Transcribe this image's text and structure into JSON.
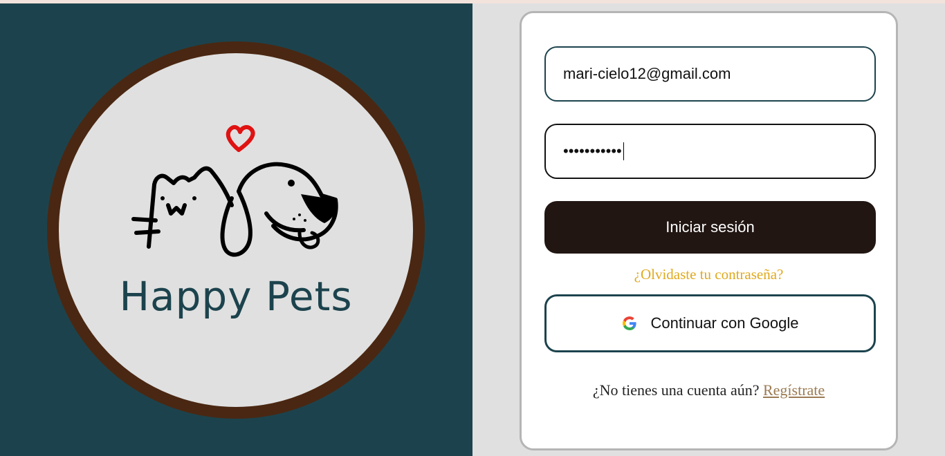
{
  "brand": {
    "name": "Happy Pets"
  },
  "login": {
    "email_value": "mari-cielo12@gmail.com",
    "password_masked": "•••••••••••",
    "submit_label": "Iniciar sesión",
    "forgot_label": "¿Olvidaste tu contraseña?",
    "google_label": "Continuar con Google",
    "signup_prompt": "¿No tienes una cuenta aún?",
    "signup_link": "Regístrate"
  },
  "colors": {
    "left_panel": "#1c434d",
    "circle_border": "#4a2712",
    "submit_button": "#211612",
    "forgot_link": "#e0a91c",
    "signup_link": "#9b7a52",
    "heart": "#e01212"
  },
  "icons": {
    "logo": "cat-dog-heart-logo",
    "google": "google-g-icon"
  }
}
